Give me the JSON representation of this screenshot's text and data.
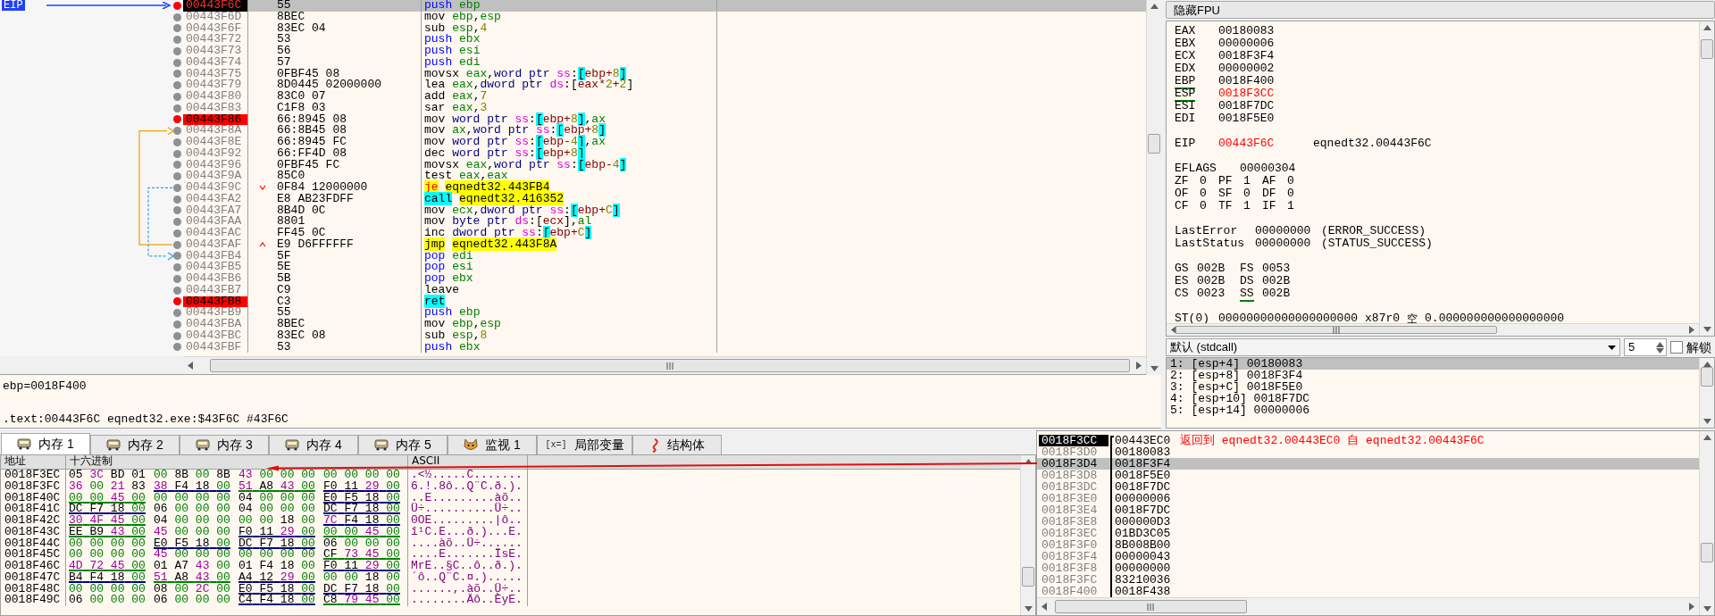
{
  "disassembly": {
    "eip_label": "EIP",
    "rows": [
      {
        "address": "00443F6C",
        "bytes": "55",
        "mnemonic": "push",
        "operands": "ebp",
        "kind": "stack",
        "current": true,
        "breakpoint": true
      },
      {
        "address": "00443F6D",
        "bytes": "8BEC",
        "mnemonic": "mov",
        "operands": "ebp,esp",
        "kind": "plain",
        "current": false,
        "breakpoint": false
      },
      {
        "address": "00443F6F",
        "bytes": "83EC 04",
        "mnemonic": "sub",
        "operands": "esp,4",
        "kind": "plain",
        "current": false,
        "breakpoint": false
      },
      {
        "address": "00443F72",
        "bytes": "53",
        "mnemonic": "push",
        "operands": "ebx",
        "kind": "stack",
        "current": false,
        "breakpoint": false
      },
      {
        "address": "00443F73",
        "bytes": "56",
        "mnemonic": "push",
        "operands": "esi",
        "kind": "stack",
        "current": false,
        "breakpoint": false
      },
      {
        "address": "00443F74",
        "bytes": "57",
        "mnemonic": "push",
        "operands": "edi",
        "kind": "stack",
        "current": false,
        "breakpoint": false
      },
      {
        "address": "00443F75",
        "bytes": "0FBF45 08",
        "mnemonic": "movsx",
        "operands": "eax,word ptr ss:[ebp+8]",
        "kind": "plain",
        "bracket_highlight": true,
        "current": false,
        "breakpoint": false
      },
      {
        "address": "00443F79",
        "bytes": "8D0445 02000000",
        "mnemonic": "lea",
        "operands": "eax,dword ptr ds:[eax*2+2]",
        "kind": "plain",
        "current": false,
        "breakpoint": false
      },
      {
        "address": "00443F80",
        "bytes": "83C0 07",
        "mnemonic": "add",
        "operands": "eax,7",
        "kind": "plain",
        "current": false,
        "breakpoint": false
      },
      {
        "address": "00443F83",
        "bytes": "C1F8 03",
        "mnemonic": "sar",
        "operands": "eax,3",
        "kind": "plain",
        "current": false,
        "breakpoint": false
      },
      {
        "address": "00443F86",
        "bytes": "66:8945 08",
        "mnemonic": "mov",
        "operands": "word ptr ss:[ebp+8],ax",
        "kind": "plain",
        "bracket_highlight": true,
        "current": false,
        "breakpoint": true
      },
      {
        "address": "00443F8A",
        "bytes": "66:8B45 08",
        "mnemonic": "mov",
        "operands": "ax,word ptr ss:[ebp+8]",
        "kind": "plain",
        "bracket_highlight": true,
        "jump_in": true,
        "conditional_jump": false,
        "current": false,
        "breakpoint": false
      },
      {
        "address": "00443F8E",
        "bytes": "66:8945 FC",
        "mnemonic": "mov",
        "operands": "word ptr ss:[ebp-4],ax",
        "kind": "plain",
        "bracket_highlight": true,
        "current": false,
        "breakpoint": false
      },
      {
        "address": "00443F92",
        "bytes": "66:FF4D 08",
        "mnemonic": "dec",
        "operands": "word ptr ss:[ebp+8]",
        "kind": "plain",
        "bracket_highlight": true,
        "current": false,
        "breakpoint": false
      },
      {
        "address": "00443F96",
        "bytes": "0FBF45 FC",
        "mnemonic": "movsx",
        "operands": "eax,word ptr ss:[ebp-4]",
        "kind": "plain",
        "bracket_highlight": true,
        "current": false,
        "breakpoint": false
      },
      {
        "address": "00443F9A",
        "bytes": "85C0",
        "mnemonic": "test",
        "operands": "eax,eax",
        "kind": "plain",
        "current": false,
        "breakpoint": false
      },
      {
        "address": "00443F9C",
        "bytes": "0F84 12000000",
        "mnemonic": "je",
        "operands": "eqnedt32.443FB4",
        "kind": "cond_jump",
        "jump_out": true,
        "conditional_jump": true,
        "current": false,
        "breakpoint": false
      },
      {
        "address": "00443FA2",
        "bytes": "E8 AB23FDFF",
        "mnemonic": "call",
        "operands": "eqnedt32.416352",
        "kind": "call",
        "current": false,
        "breakpoint": false
      },
      {
        "address": "00443FA7",
        "bytes": "8B4D 0C",
        "mnemonic": "mov",
        "operands": "ecx,dword ptr ss:[ebp+C]",
        "kind": "plain",
        "bracket_highlight": true,
        "current": false,
        "breakpoint": false
      },
      {
        "address": "00443FAA",
        "bytes": "8801",
        "mnemonic": "mov",
        "operands": "byte ptr ds:[ecx],al",
        "kind": "plain",
        "current": false,
        "breakpoint": false
      },
      {
        "address": "00443FAC",
        "bytes": "FF45 0C",
        "mnemonic": "inc",
        "operands": "dword ptr ss:[ebp+C]",
        "kind": "plain",
        "bracket_highlight": true,
        "current": false,
        "breakpoint": false
      },
      {
        "address": "00443FAF",
        "bytes": "E9 D6FFFFFF",
        "mnemonic": "jmp",
        "operands": "eqnedt32.443F8A",
        "kind": "jump",
        "jump_out": true,
        "conditional_jump": false,
        "current": false,
        "breakpoint": false
      },
      {
        "address": "00443FB4",
        "bytes": "5F",
        "mnemonic": "pop",
        "operands": "edi",
        "kind": "stack",
        "jump_in": true,
        "conditional_jump": true,
        "current": false,
        "breakpoint": false
      },
      {
        "address": "00443FB5",
        "bytes": "5E",
        "mnemonic": "pop",
        "operands": "esi",
        "kind": "stack",
        "current": false,
        "breakpoint": false
      },
      {
        "address": "00443FB6",
        "bytes": "5B",
        "mnemonic": "pop",
        "operands": "ebx",
        "kind": "stack",
        "current": false,
        "breakpoint": false
      },
      {
        "address": "00443FB7",
        "bytes": "C9",
        "mnemonic": "leave",
        "operands": "",
        "kind": "plain",
        "current": false,
        "breakpoint": false
      },
      {
        "address": "00443FB8",
        "bytes": "C3",
        "mnemonic": "ret",
        "operands": "",
        "kind": "ret",
        "current": false,
        "breakpoint": true
      },
      {
        "address": "00443FB9",
        "bytes": "55",
        "mnemonic": "push",
        "operands": "ebp",
        "kind": "stack",
        "current": false,
        "breakpoint": false
      },
      {
        "address": "00443FBA",
        "bytes": "8BEC",
        "mnemonic": "mov",
        "operands": "ebp,esp",
        "kind": "plain",
        "current": false,
        "breakpoint": false
      },
      {
        "address": "00443FBC",
        "bytes": "83EC 08",
        "mnemonic": "sub",
        "operands": "esp,8",
        "kind": "plain",
        "current": false,
        "breakpoint": false
      },
      {
        "address": "00443FBF",
        "bytes": "53",
        "mnemonic": "push",
        "operands": "ebx",
        "kind": "stack",
        "current": false,
        "breakpoint": false
      }
    ]
  },
  "info": [
    "ebp=0018F400",
    ".text:00443F6C eqnedt32.exe:$43F6C #43F6C"
  ],
  "registers_panel": {
    "toggle_button": "隐藏FPU",
    "registers": [
      {
        "name": "EAX",
        "value": "00180083",
        "underlined": false,
        "changed": false
      },
      {
        "name": "EBX",
        "value": "00000006",
        "underlined": false,
        "changed": false
      },
      {
        "name": "ECX",
        "value": "0018F3F4",
        "underlined": false,
        "changed": false
      },
      {
        "name": "EDX",
        "value": "00000002",
        "underlined": false,
        "changed": false
      },
      {
        "name": "EBP",
        "value": "0018F400",
        "underlined": true,
        "changed": false
      },
      {
        "name": "ESP",
        "value": "0018F3CC",
        "underlined": true,
        "changed": true
      },
      {
        "name": "ESI",
        "value": "0018F7DC",
        "underlined": false,
        "changed": false
      },
      {
        "name": "EDI",
        "value": "0018F5E0",
        "underlined": false,
        "changed": false
      }
    ],
    "eip": {
      "name": "EIP",
      "value": "00443F6C",
      "symbol": "eqnedt32.00443F6C",
      "changed": true
    },
    "eflags": {
      "name": "EFLAGS",
      "value": "00000304"
    },
    "flags": [
      {
        "name": "ZF",
        "value": "0"
      },
      {
        "name": "PF",
        "value": "1"
      },
      {
        "name": "AF",
        "value": "0"
      },
      {
        "name": "OF",
        "value": "0"
      },
      {
        "name": "SF",
        "value": "0"
      },
      {
        "name": "DF",
        "value": "0"
      },
      {
        "name": "CF",
        "value": "0"
      },
      {
        "name": "TF",
        "value": "1"
      },
      {
        "name": "IF",
        "value": "1"
      }
    ],
    "last": [
      {
        "name": "LastError",
        "value": "00000000",
        "description": "(ERROR_SUCCESS)"
      },
      {
        "name": "LastStatus",
        "value": "00000000",
        "description": "(STATUS_SUCCESS)"
      }
    ],
    "segments": [
      {
        "name": "GS",
        "value": "002B",
        "underlined": false
      },
      {
        "name": "FS",
        "value": "0053",
        "underlined": false
      },
      {
        "name": "ES",
        "value": "002B",
        "underlined": false
      },
      {
        "name": "DS",
        "value": "002B",
        "underlined": false
      },
      {
        "name": "CS",
        "value": "0023",
        "underlined": false
      },
      {
        "name": "SS",
        "value": "002B",
        "underlined": true
      }
    ],
    "fpu": [
      {
        "name": "ST(0)",
        "value": "00000000000000000000",
        "tag": "x87r0",
        "status": "空",
        "float": "0.000000000000000000"
      }
    ]
  },
  "call_stack_args": {
    "convention": "默认 (stdcall)",
    "count": "5",
    "lock_label": "解锁",
    "locked": false,
    "args": [
      {
        "text": "1: [esp+4] 00180083",
        "selected": true
      },
      {
        "text": "2: [esp+8] 0018F3F4",
        "selected": false
      },
      {
        "text": "3: [esp+C] 0018F5E0",
        "selected": false
      },
      {
        "text": "4: [esp+10] 0018F7DC",
        "selected": false
      },
      {
        "text": "5: [esp+14] 00000006",
        "selected": false
      }
    ]
  },
  "tabs": [
    {
      "label": "内存 1",
      "kind": "memory",
      "selected": true
    },
    {
      "label": "内存 2",
      "kind": "memory",
      "selected": false
    },
    {
      "label": "内存 3",
      "kind": "memory",
      "selected": false
    },
    {
      "label": "内存 4",
      "kind": "memory",
      "selected": false
    },
    {
      "label": "内存 5",
      "kind": "memory",
      "selected": false
    },
    {
      "label": "监视 1",
      "kind": "watch",
      "selected": false
    },
    {
      "label": "局部变量",
      "kind": "variables",
      "icon_text": "[x=]",
      "selected": false
    },
    {
      "label": "结构体",
      "kind": "struct",
      "selected": false
    }
  ],
  "dump": {
    "columns": [
      "地址",
      "十六进制",
      "ASCII"
    ],
    "rows": [
      {
        "address": "0018F3EC",
        "groups": [
          {
            "hex": "05 3C BD 01"
          },
          {
            "hex": "00 8B 00 8B"
          },
          {
            "hex": "43 00 00 00"
          },
          {
            "hex": "00 00 00 00"
          }
        ],
        "ascii": ".<½.....C......."
      },
      {
        "address": "0018F3FC",
        "groups": [
          {
            "hex": "36 00 21 83"
          },
          {
            "hex": "38 F4 18 00",
            "color": "#000080"
          },
          {
            "hex": "51 A8 43 00",
            "color": "#008000"
          },
          {
            "hex": "F0 11 29 00",
            "color": "#000080"
          }
        ],
        "ascii": "6.!.8ô..Q¨C.ð.)."
      },
      {
        "address": "0018F40C",
        "groups": [
          {
            "hex": "00 00 45 00",
            "color": "#008000"
          },
          {
            "hex": "00 00 00 00"
          },
          {
            "hex": "04 00 00 00"
          },
          {
            "hex": "E0 F5 18 00",
            "color": "#000080"
          }
        ],
        "ascii": "..E.........àõ.."
      },
      {
        "address": "0018F41C",
        "groups": [
          {
            "hex": "DC F7 18 00",
            "color": "#000080"
          },
          {
            "hex": "06 00 00 00"
          },
          {
            "hex": "04 00 00 00"
          },
          {
            "hex": "DC F7 18 00",
            "color": "#000080"
          }
        ],
        "ascii": "Ü÷..........Ü÷.."
      },
      {
        "address": "0018F42C",
        "groups": [
          {
            "hex": "30 4F 45 00",
            "color": "#008000"
          },
          {
            "hex": "04 00 00 00"
          },
          {
            "hex": "00 00 18 00"
          },
          {
            "hex": "7C F4 18 00",
            "color": "#000080"
          }
        ],
        "ascii": "0OE.........|ô.."
      },
      {
        "address": "0018F43C",
        "groups": [
          {
            "hex": "EE B9 43 00",
            "color": "#008000"
          },
          {
            "hex": "45 00 00 00"
          },
          {
            "hex": "F0 11 29 00",
            "color": "#000080"
          },
          {
            "hex": "00 00 45 00",
            "color": "#008000"
          }
        ],
        "ascii": "î¹C.E...ð.)...E."
      },
      {
        "address": "0018F44C",
        "groups": [
          {
            "hex": "00 00 00 00"
          },
          {
            "hex": "E0 F5 18 00",
            "color": "#000080"
          },
          {
            "hex": "DC F7 18 00",
            "color": "#000080"
          },
          {
            "hex": "06 00 00 00"
          }
        ],
        "ascii": "....àõ..Ü÷......"
      },
      {
        "address": "0018F45C",
        "groups": [
          {
            "hex": "00 00 00 00"
          },
          {
            "hex": "45 00 00 00"
          },
          {
            "hex": "00 00 00 00"
          },
          {
            "hex": "CF 73 45 00",
            "color": "#008000"
          }
        ],
        "ascii": "....E.......ÏsE."
      },
      {
        "address": "0018F46C",
        "groups": [
          {
            "hex": "4D 72 45 00",
            "color": "#008000"
          },
          {
            "hex": "01 A7 43 00"
          },
          {
            "hex": "01 F4 18 00"
          },
          {
            "hex": "F0 11 29 00",
            "color": "#000080"
          }
        ],
        "ascii": "MrE..§C..ô..ð.)."
      },
      {
        "address": "0018F47C",
        "groups": [
          {
            "hex": "B4 F4 18 00",
            "color": "#000080"
          },
          {
            "hex": "51 A8 43 00",
            "color": "#008000"
          },
          {
            "hex": "A4 12 29 00",
            "color": "#000080"
          },
          {
            "hex": "00 00 18 00"
          }
        ],
        "ascii": "´ô..Q¨C.¤.)....."
      },
      {
        "address": "0018F48C",
        "groups": [
          {
            "hex": "00 00 00 00"
          },
          {
            "hex": "08 00 2C 00"
          },
          {
            "hex": "E0 F5 18 00",
            "color": "#000080"
          },
          {
            "hex": "DC F7 18 00",
            "color": "#000080"
          }
        ],
        "ascii": "......,.àõ..Ü÷.."
      },
      {
        "address": "0018F49C",
        "groups": [
          {
            "hex": "06 00 00 00"
          },
          {
            "hex": "06 00 00 00"
          },
          {
            "hex": "C4 F4 18 00",
            "color": "#000080"
          },
          {
            "hex": "C8 79 45 00",
            "color": "#008000"
          }
        ],
        "ascii": "........Äô..ÈyE."
      }
    ]
  },
  "stack": {
    "rows": [
      {
        "address": "0018F3CC",
        "value": "00443EC0",
        "comment": "返回到 eqnedt32.00443EC0 自 eqnedt32.00443F6C",
        "current": true,
        "selected": false
      },
      {
        "address": "0018F3D0",
        "value": "00180083",
        "current": false,
        "selected": false
      },
      {
        "address": "0018F3D4",
        "value": "0018F3F4",
        "current": false,
        "selected": true
      },
      {
        "address": "0018F3D8",
        "value": "0018F5E0",
        "current": false,
        "selected": false
      },
      {
        "address": "0018F3DC",
        "value": "0018F7DC",
        "current": false,
        "selected": false
      },
      {
        "address": "0018F3E0",
        "value": "00000006",
        "current": false,
        "selected": false
      },
      {
        "address": "0018F3E4",
        "value": "0018F7DC",
        "current": false,
        "selected": false
      },
      {
        "address": "0018F3E8",
        "value": "000000D3",
        "current": false,
        "selected": false
      },
      {
        "address": "0018F3EC",
        "value": "01BD3C05",
        "current": false,
        "selected": false
      },
      {
        "address": "0018F3F0",
        "value": "8B008B00",
        "current": false,
        "selected": false
      },
      {
        "address": "0018F3F4",
        "value": "00000043",
        "current": false,
        "selected": false
      },
      {
        "address": "0018F3F8",
        "value": "00000000",
        "current": false,
        "selected": false
      },
      {
        "address": "0018F3FC",
        "value": "83210036",
        "current": false,
        "selected": false
      },
      {
        "address": "0018F400",
        "value": "0018F438",
        "current": false,
        "selected": false
      }
    ]
  }
}
